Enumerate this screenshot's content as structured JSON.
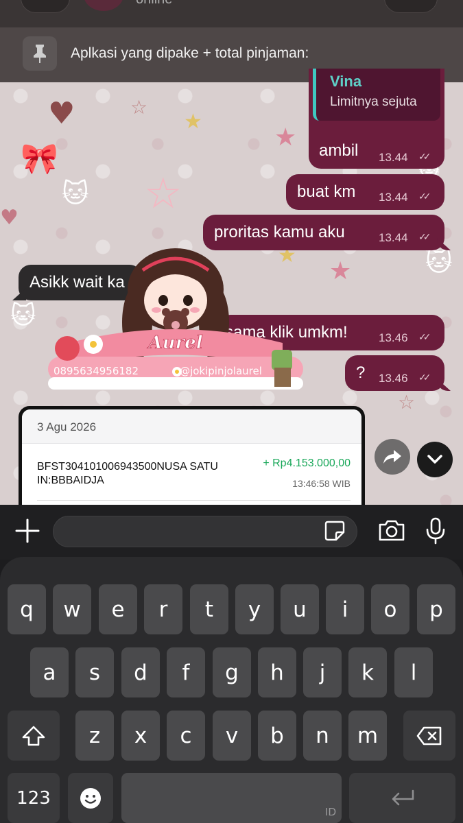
{
  "header": {
    "status_text": "online",
    "pinned_text": "Aplkasi yang dipake + total pinjaman:"
  },
  "messages": {
    "quote": {
      "name": "Vina",
      "text": "Limitnya sejuta"
    },
    "m1": {
      "text": "ambil",
      "time": "13.44"
    },
    "m2": {
      "text": "buat km",
      "time": "13.44"
    },
    "m3": {
      "text": "proritas kamu aku",
      "time": "13.44"
    },
    "incoming1": {
      "text": "Asikk wait ka"
    },
    "m4": {
      "text": "sama klik umkm!",
      "time": "13.46"
    },
    "m5": {
      "text": "?",
      "time": "13.46"
    }
  },
  "sticker": {
    "name": "Aurel",
    "phone": "0895634956182",
    "handle": "@jokipinjolaurel"
  },
  "receipt": {
    "date": "3 Agu 2026",
    "description": "BFST304101006943500NUSA SATU IN:BBBAIDJA",
    "amount": "+ Rp4.153.000,00",
    "time": "13:46:58 WIB"
  },
  "keyboard": {
    "row1": [
      "q",
      "w",
      "e",
      "r",
      "t",
      "y",
      "u",
      "i",
      "o",
      "p"
    ],
    "row2": [
      "a",
      "s",
      "d",
      "f",
      "g",
      "h",
      "j",
      "k",
      "l"
    ],
    "row3": [
      "z",
      "x",
      "c",
      "v",
      "b",
      "n",
      "m"
    ],
    "numbers_label": "123",
    "language_label": "ID"
  },
  "colors": {
    "bubble_out": "#6b1d3c",
    "bubble_in": "#2c2a2b",
    "quote_accent": "#3fc7c0",
    "amount_green": "#1aa85a"
  },
  "icons": [
    "pin-icon",
    "forward-icon",
    "scroll-down-icon",
    "plus-icon",
    "sticker-icon",
    "camera-icon",
    "mic-icon",
    "shift-icon",
    "backspace-icon",
    "emoji-icon",
    "return-icon"
  ]
}
